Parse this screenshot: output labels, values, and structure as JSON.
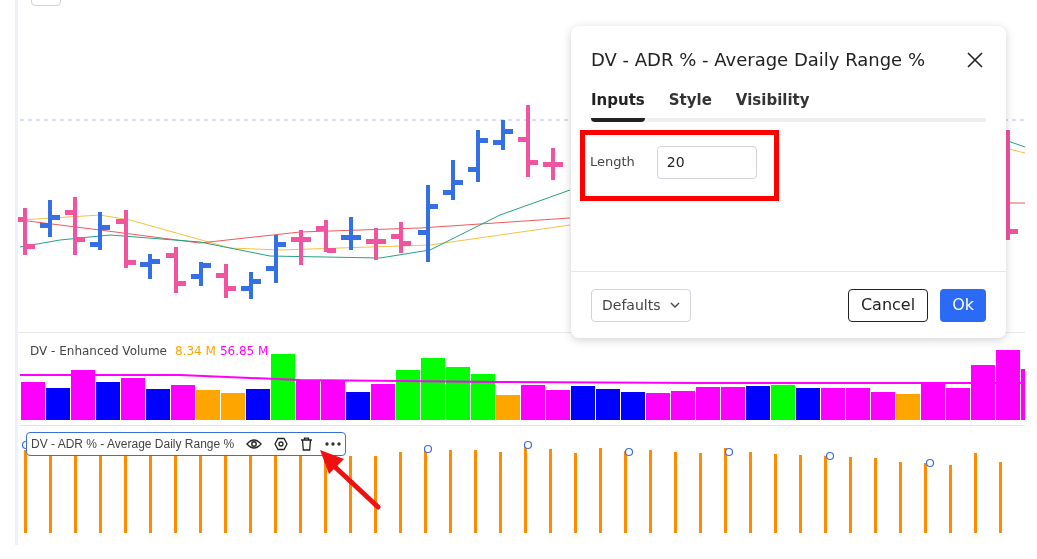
{
  "chart": {
    "volume_pane": {
      "title": "DV - Enhanced Volume",
      "values": [
        {
          "text": "8.34 M",
          "color": "#ffa500"
        },
        {
          "text": "56.85 M",
          "color": "#ff00ff"
        }
      ]
    },
    "indicator_legend": {
      "title": "DV - ADR % - Average Daily Range %"
    }
  },
  "dialog": {
    "title": "DV - ADR % - Average Daily Range %",
    "tabs": [
      {
        "label": "Inputs",
        "selected": true
      },
      {
        "label": "Style",
        "selected": false
      },
      {
        "label": "Visibility",
        "selected": false
      }
    ],
    "inputs": [
      {
        "label": "Length",
        "value": "20"
      }
    ],
    "defaults": "Defaults",
    "buttons": [
      {
        "label": "Cancel",
        "kind": "secondary"
      },
      {
        "label": "Ok",
        "kind": "primary"
      }
    ]
  }
}
